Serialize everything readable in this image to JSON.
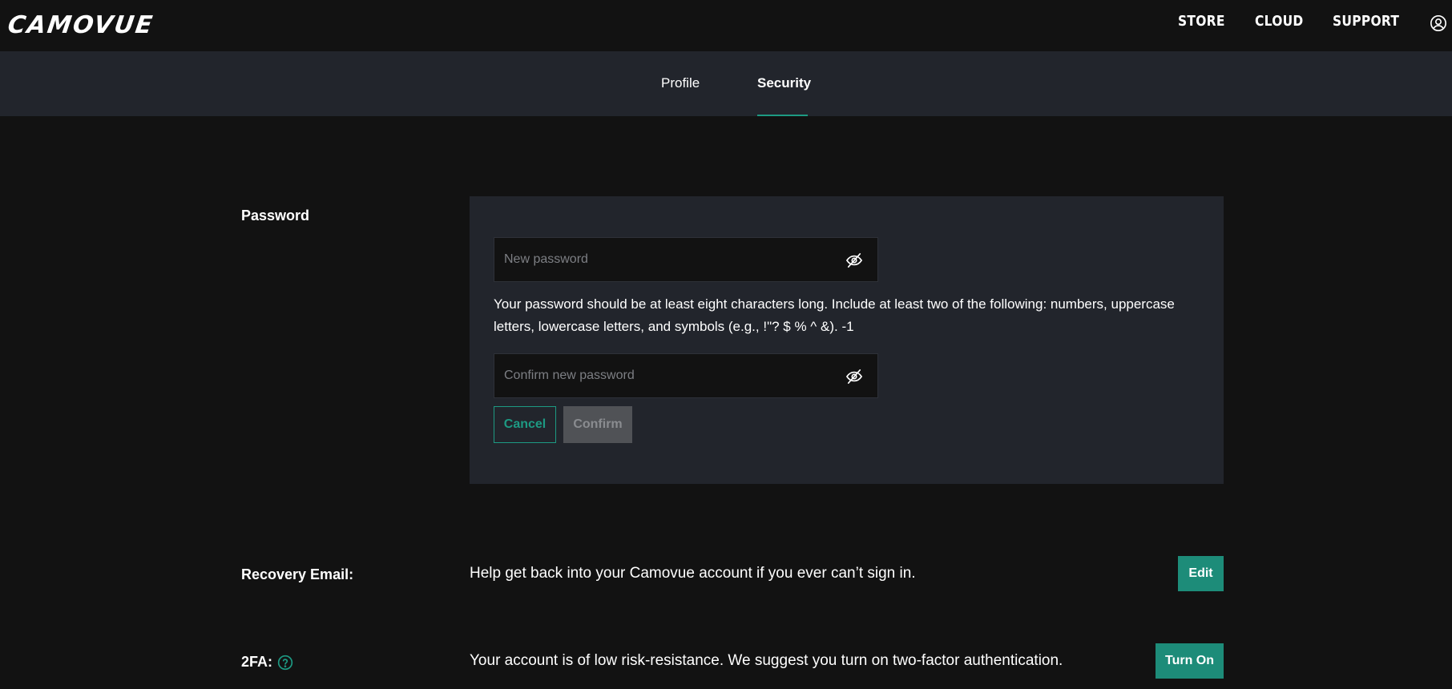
{
  "header": {
    "logo": "CAMOVUE",
    "nav": {
      "store": "STORE",
      "cloud": "CLOUD",
      "support": "SUPPORT"
    },
    "account_icon": "user-circle-icon"
  },
  "tabs": {
    "profile": "Profile",
    "security": "Security",
    "active": "Security"
  },
  "password": {
    "label": "Password",
    "new_placeholder": "New password",
    "new_value": "",
    "hint": "Your password should be at least eight characters long. Include at least two of the following: numbers, uppercase letters, lowercase letters, and symbols (e.g., !\"? $ % ^ &). -1",
    "confirm_placeholder": "Confirm new password",
    "confirm_value": "",
    "visibility_icon": "eye-slash-icon",
    "cancel_label": "Cancel",
    "confirm_label": "Confirm"
  },
  "recovery": {
    "label": "Recovery Email:",
    "description": "Help get back into your Camovue account if you ever can’t sign in.",
    "button": "Edit"
  },
  "twofa": {
    "label": "2FA:",
    "help_icon": "question-circle-icon",
    "description": "Your account is of low risk-resistance. We suggest you turn on two-factor authentication.",
    "button": "Turn On"
  },
  "colors": {
    "background": "#121212",
    "panel": "#22252c",
    "accent": "#1d9a83",
    "button_primary": "#1d8c79",
    "button_disabled": "#505256"
  }
}
